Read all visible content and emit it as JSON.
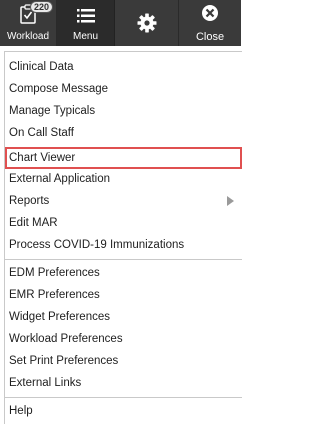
{
  "toolbar": {
    "workload_label": "Workload",
    "workload_badge": "220",
    "menu_label": "Menu",
    "close_label": "Close"
  },
  "menu": {
    "group1": [
      {
        "label": "Clinical Data"
      },
      {
        "label": "Compose Message"
      },
      {
        "label": "Manage Typicals"
      },
      {
        "label": "On Call Staff"
      },
      {
        "label": "Chart Viewer"
      },
      {
        "label": "External Application"
      },
      {
        "label": "Reports"
      },
      {
        "label": "Edit MAR"
      },
      {
        "label": "Process COVID-19 Immunizations"
      }
    ],
    "group2": [
      {
        "label": "EDM Preferences"
      },
      {
        "label": "EMR Preferences"
      },
      {
        "label": "Widget Preferences"
      },
      {
        "label": "Workload Preferences"
      },
      {
        "label": "Set Print Preferences"
      },
      {
        "label": "External Links"
      }
    ],
    "group3": [
      {
        "label": "Help"
      }
    ]
  },
  "colors": {
    "toolbar_bg": "#3a3a3a",
    "selection_border": "#e05050"
  },
  "icons": {
    "workload": "clipboard-check-icon",
    "menu": "hamburger-icon",
    "settings": "gear-icon",
    "close": "close-circle-icon",
    "submenu": "chevron-right-icon"
  }
}
